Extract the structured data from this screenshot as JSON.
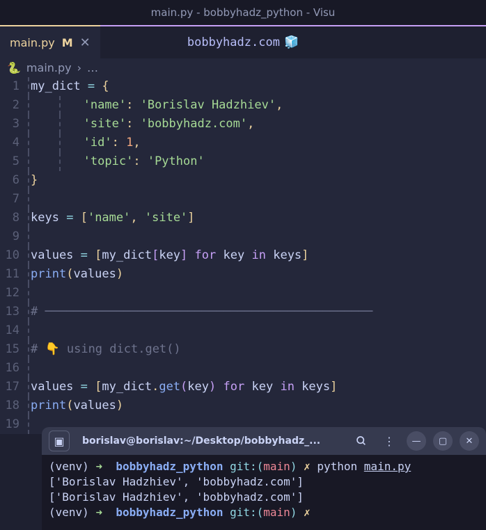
{
  "window": {
    "title": "main.py - bobbyhadz_python - Visu"
  },
  "tab": {
    "filename": "main.py",
    "modified_indicator": "M",
    "close_glyph": "✕"
  },
  "watermark": {
    "text": "bobbyhadz.com",
    "icon": "🧊"
  },
  "breadcrumb": {
    "file": "main.py",
    "separator": "›",
    "ellipsis": "…"
  },
  "code": {
    "lines": [
      {
        "n": 1,
        "tokens": [
          [
            "var",
            "my_dict"
          ],
          [
            "sp",
            " "
          ],
          [
            "op",
            "="
          ],
          [
            "sp",
            " "
          ],
          [
            "b1",
            "{"
          ]
        ]
      },
      {
        "n": 2,
        "indent": 2,
        "tokens": [
          [
            "str",
            "'name'"
          ],
          [
            "punc",
            ":"
          ],
          [
            "sp",
            " "
          ],
          [
            "str",
            "'Borislav Hadzhiev'"
          ],
          [
            "punc",
            ","
          ]
        ]
      },
      {
        "n": 3,
        "indent": 2,
        "tokens": [
          [
            "str",
            "'site'"
          ],
          [
            "punc",
            ":"
          ],
          [
            "sp",
            " "
          ],
          [
            "str",
            "'bobbyhadz.com'"
          ],
          [
            "punc",
            ","
          ]
        ]
      },
      {
        "n": 4,
        "indent": 2,
        "tokens": [
          [
            "str",
            "'id'"
          ],
          [
            "punc",
            ":"
          ],
          [
            "sp",
            " "
          ],
          [
            "num",
            "1"
          ],
          [
            "punc",
            ","
          ]
        ]
      },
      {
        "n": 5,
        "indent": 2,
        "tokens": [
          [
            "str",
            "'topic'"
          ],
          [
            "punc",
            ":"
          ],
          [
            "sp",
            " "
          ],
          [
            "str",
            "'Python'"
          ]
        ]
      },
      {
        "n": 6,
        "indent": 0,
        "tokens": [
          [
            "b1",
            "}"
          ]
        ]
      },
      {
        "n": 7,
        "tokens": []
      },
      {
        "n": 8,
        "tokens": [
          [
            "var",
            "keys"
          ],
          [
            "sp",
            " "
          ],
          [
            "op",
            "="
          ],
          [
            "sp",
            " "
          ],
          [
            "b1",
            "["
          ],
          [
            "str",
            "'name'"
          ],
          [
            "punc",
            ","
          ],
          [
            "sp",
            " "
          ],
          [
            "str",
            "'site'"
          ],
          [
            "b1",
            "]"
          ]
        ]
      },
      {
        "n": 9,
        "tokens": []
      },
      {
        "n": 10,
        "tokens": [
          [
            "var",
            "values"
          ],
          [
            "sp",
            " "
          ],
          [
            "op",
            "="
          ],
          [
            "sp",
            " "
          ],
          [
            "b1",
            "["
          ],
          [
            "var",
            "my_dict"
          ],
          [
            "b2",
            "["
          ],
          [
            "var",
            "key"
          ],
          [
            "b2",
            "]"
          ],
          [
            "sp",
            " "
          ],
          [
            "kw",
            "for"
          ],
          [
            "sp",
            " "
          ],
          [
            "var",
            "key"
          ],
          [
            "sp",
            " "
          ],
          [
            "kw",
            "in"
          ],
          [
            "sp",
            " "
          ],
          [
            "var",
            "keys"
          ],
          [
            "b1",
            "]"
          ]
        ]
      },
      {
        "n": 11,
        "tokens": [
          [
            "func",
            "print"
          ],
          [
            "b1",
            "("
          ],
          [
            "var",
            "values"
          ],
          [
            "b1",
            ")"
          ]
        ]
      },
      {
        "n": 12,
        "tokens": []
      },
      {
        "n": 13,
        "tokens": [
          [
            "comment",
            "# ──────────────────────────────────────────────"
          ]
        ]
      },
      {
        "n": 14,
        "tokens": []
      },
      {
        "n": 15,
        "tokens": [
          [
            "comment",
            "# 👇 using dict.get()"
          ]
        ]
      },
      {
        "n": 16,
        "tokens": []
      },
      {
        "n": 17,
        "tokens": [
          [
            "var",
            "values"
          ],
          [
            "sp",
            " "
          ],
          [
            "op",
            "="
          ],
          [
            "sp",
            " "
          ],
          [
            "b1",
            "["
          ],
          [
            "var",
            "my_dict"
          ],
          [
            "punc",
            "."
          ],
          [
            "func",
            "get"
          ],
          [
            "b2",
            "("
          ],
          [
            "var",
            "key"
          ],
          [
            "b2",
            ")"
          ],
          [
            "sp",
            " "
          ],
          [
            "kw",
            "for"
          ],
          [
            "sp",
            " "
          ],
          [
            "var",
            "key"
          ],
          [
            "sp",
            " "
          ],
          [
            "kw",
            "in"
          ],
          [
            "sp",
            " "
          ],
          [
            "var",
            "keys"
          ],
          [
            "b1",
            "]"
          ]
        ]
      },
      {
        "n": 18,
        "tokens": [
          [
            "func",
            "print"
          ],
          [
            "b1",
            "("
          ],
          [
            "var",
            "values"
          ],
          [
            "b1",
            ")"
          ]
        ]
      },
      {
        "n": 19,
        "tokens": []
      }
    ]
  },
  "terminal": {
    "title": "borislav@borislav:~/Desktop/bobbyhadz_...",
    "lines": [
      [
        [
          "white",
          "(venv) "
        ],
        [
          "green",
          "➜  "
        ],
        [
          "blue",
          "bobbyhadz_python"
        ],
        [
          "white",
          " "
        ],
        [
          "cyan",
          "git:("
        ],
        [
          "red",
          "main"
        ],
        [
          "cyan",
          ")"
        ],
        [
          "white",
          " "
        ],
        [
          "yellow",
          "✗"
        ],
        [
          "white",
          " python "
        ],
        [
          "underline",
          "main.py"
        ]
      ],
      [
        [
          "white",
          "['Borislav Hadzhiev', 'bobbyhadz.com']"
        ]
      ],
      [
        [
          "white",
          "['Borislav Hadzhiev', 'bobbyhadz.com']"
        ]
      ],
      [
        [
          "white",
          "(venv) "
        ],
        [
          "green",
          "➜  "
        ],
        [
          "blue",
          "bobbyhadz_python"
        ],
        [
          "white",
          " "
        ],
        [
          "cyan",
          "git:("
        ],
        [
          "red",
          "main"
        ],
        [
          "cyan",
          ")"
        ],
        [
          "white",
          " "
        ],
        [
          "yellow",
          "✗"
        ]
      ]
    ]
  }
}
